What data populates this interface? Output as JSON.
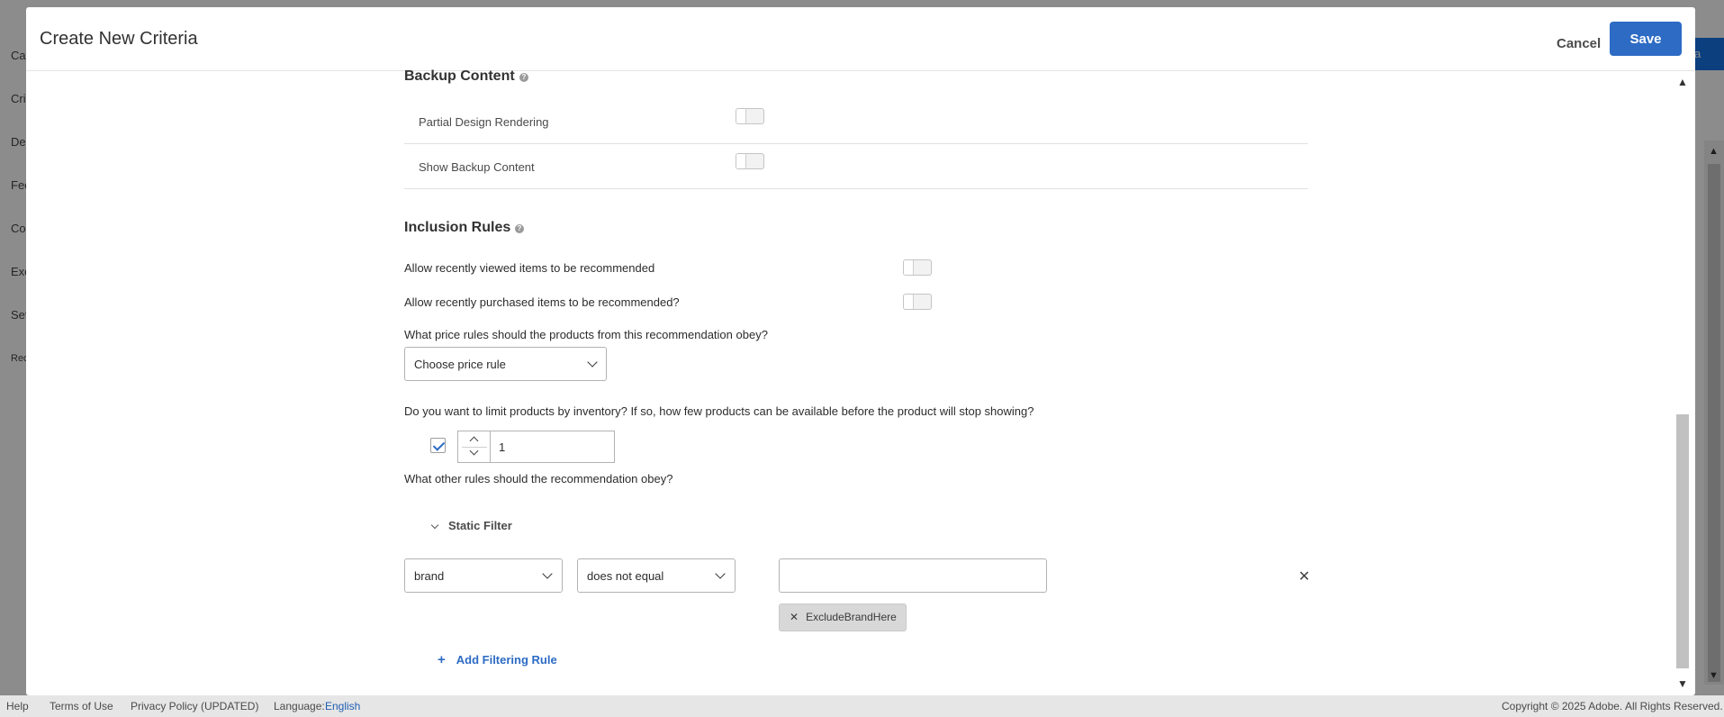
{
  "background": {
    "nav_items": [
      "Cat",
      "Cri",
      "De",
      "Fee",
      "Co",
      "Exc",
      "Set",
      "Rec"
    ],
    "button_label": "a"
  },
  "modal": {
    "title": "Create New Criteria",
    "cancel_label": "Cancel",
    "save_label": "Save"
  },
  "backup_content": {
    "title": "Backup Content",
    "help_icon": "?",
    "rows": [
      {
        "label": "Partial Design Rendering",
        "enabled": false
      },
      {
        "label": "Show Backup Content",
        "enabled": false
      }
    ]
  },
  "inclusion_rules": {
    "title": "Inclusion Rules",
    "help_icon": "?",
    "recently_viewed_label": "Allow recently viewed items to be recommended",
    "recently_viewed_enabled": false,
    "recently_purchased_label": "Allow recently purchased items to be recommended?",
    "recently_purchased_enabled": false,
    "price_rule_question": "What price rules should the products from this recommendation obey?",
    "price_rule_value": "Choose price rule",
    "inventory_question": "Do you want to limit products by inventory?  If so, how few products can be available before the product will stop showing?",
    "inventory_enabled": true,
    "inventory_value": "1",
    "other_rules_question": "What other rules should the recommendation obey?",
    "static_filter_label": "Static Filter",
    "filter": {
      "attribute": "brand",
      "operator": "does not equal",
      "value": "",
      "tags": [
        "ExcludeBrandHere"
      ],
      "remove_glyph": "✕",
      "tag_remove_glyph": "✕"
    },
    "add_rule_label": "Add Filtering Rule",
    "add_rule_glyph": "+"
  },
  "footer": {
    "help": "Help",
    "terms": "Terms of Use",
    "privacy": "Privacy Policy (UPDATED)",
    "language_label": "Language:",
    "language_value": "English",
    "copyright": "Copyright © 2025 Adobe. All Rights Reserved."
  },
  "colors": {
    "primary": "#2d6bc4",
    "overlay": "rgba(0,0,0,0.45)"
  }
}
